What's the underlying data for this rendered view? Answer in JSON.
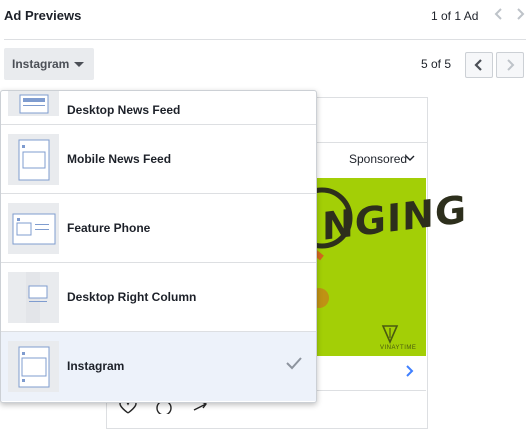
{
  "header": {
    "title": "Ad Previews",
    "counter": "1 of 1 Ad",
    "prev_icon": "chevron-left-icon",
    "next_icon": "chevron-right-icon"
  },
  "placement": {
    "selected_label": "Instagram",
    "counter": "5 of 5"
  },
  "dropdown": {
    "items": [
      {
        "label": "Desktop News Feed",
        "icon": "desktop-news-feed-thumbnail"
      },
      {
        "label": "Mobile News Feed",
        "icon": "mobile-news-feed-thumbnail"
      },
      {
        "label": "Feature Phone",
        "icon": "feature-phone-thumbnail"
      },
      {
        "label": "Desktop Right Column",
        "icon": "desktop-right-column-thumbnail"
      },
      {
        "label": "Instagram",
        "icon": "instagram-thumbnail",
        "selected": true
      }
    ]
  },
  "preview": {
    "sponsored": "Sponsored",
    "ad_headline": "NGING",
    "brand_text": "VINAYTIME"
  },
  "colors": {
    "accent": "#4080ff",
    "ad_background": "#a3cf06",
    "selected_row": "#edf2fa"
  }
}
